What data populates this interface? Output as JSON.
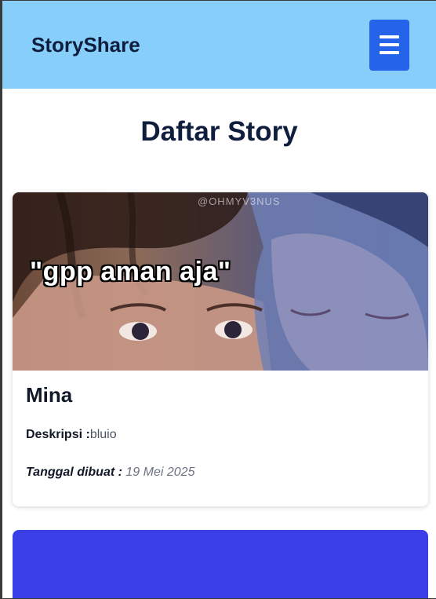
{
  "header": {
    "brand": "StoryShare",
    "menu_icon": "hamburger-menu-icon",
    "bg_color": "#87cefa",
    "menu_color": "#2563eb"
  },
  "main": {
    "title": "Daftar Story"
  },
  "stories": [
    {
      "image_caption": "\"gpp aman aja\"",
      "image_watermark": "@OHMYV3NUS",
      "name": "Mina",
      "description_label": "Deskripsi :",
      "description": "bluio",
      "date_label": "Tanggal dibuat :",
      "date": "19 Mei 2025"
    }
  ],
  "next_card_color": "#3b3fe8"
}
